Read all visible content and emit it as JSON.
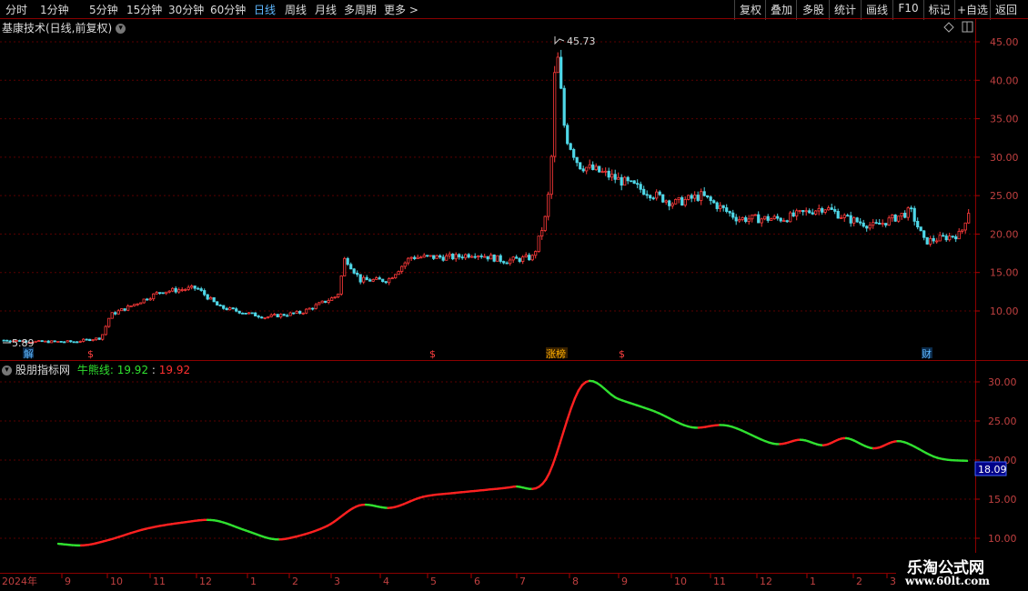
{
  "toolbar": {
    "periods": [
      "分时",
      "1分钟",
      "5分钟",
      "15分钟",
      "30分钟",
      "60分钟",
      "日线",
      "周线",
      "月线",
      "多周期",
      "更多"
    ],
    "active_period": "日线",
    "right_buttons": [
      "复权",
      "叠加",
      "多股",
      "统计",
      "画线",
      "F10",
      "标记",
      "+自选",
      "返回"
    ]
  },
  "main_chart": {
    "title": "基康技术(日线,前复权)",
    "y_ticks": [
      "45.00",
      "40.00",
      "35.00",
      "30.00",
      "25.00",
      "20.00",
      "15.00",
      "10.00"
    ],
    "high_label": "45.73",
    "low_label": "5.89",
    "markers": [
      {
        "text": "解",
        "color": "#5fb8ff"
      },
      {
        "text": "$",
        "color": "#ff4040"
      },
      {
        "text": "$",
        "color": "#ff4040"
      },
      {
        "text": "涨榜",
        "color": "#ffb000"
      },
      {
        "text": "$",
        "color": "#ff4040"
      },
      {
        "text": "财",
        "color": "#5fb8ff"
      }
    ]
  },
  "indicator": {
    "name": "股朋指标网",
    "line_label": "牛熊线:",
    "value_green": "19.92",
    "value_red": "19.92",
    "y_ticks": [
      "30.00",
      "25.00",
      "20.00",
      "15.00",
      "10.00"
    ],
    "current_value": "18.09"
  },
  "time_axis": {
    "year_label": "2024年",
    "months": [
      "9",
      "10",
      "11",
      "12",
      "1",
      "2",
      "3",
      "4",
      "5",
      "6",
      "7",
      "8",
      "9",
      "10",
      "11",
      "12",
      "1",
      "2",
      "3"
    ]
  },
  "watermark": {
    "line1": "乐淘公式网",
    "line2": "www.60lt.com"
  },
  "chart_data": {
    "type": "line",
    "title": "基康技术(日线,前复权)",
    "series": [
      {
        "name": "牛熊线",
        "x": [
          "2024-08-28",
          "2024-09-20",
          "2024-10-10",
          "2024-10-30",
          "2024-11-20",
          "2024-12-15",
          "2025-01-05",
          "2025-01-25",
          "2025-02-15",
          "2025-03-10",
          "2025-03-25",
          "2025-04-15",
          "2025-05-05",
          "2025-05-25",
          "2025-06-15",
          "2025-07-05",
          "2025-07-20",
          "2025-08-05",
          "2025-08-25",
          "2025-09-15",
          "2025-10-05",
          "2025-10-25",
          "2025-11-15",
          "2025-12-05",
          "2025-12-25",
          "2026-01-15",
          "2026-02-05",
          "2026-02-25",
          "2026-03-15",
          "2026-03-28"
        ],
        "values": [
          9.3,
          9.1,
          9.8,
          11.2,
          12.0,
          12.3,
          11.0,
          9.9,
          10.2,
          11.6,
          14.2,
          13.9,
          15.3,
          15.8,
          16.2,
          16.6,
          17.5,
          29.6,
          27.8,
          26.2,
          24.2,
          24.4,
          22.1,
          22.6,
          21.9,
          22.8,
          21.5,
          22.4,
          20.3,
          19.9
        ]
      }
    ],
    "price_range": [
      5.89,
      45.73
    ],
    "ylim": [
      8,
      32
    ]
  }
}
